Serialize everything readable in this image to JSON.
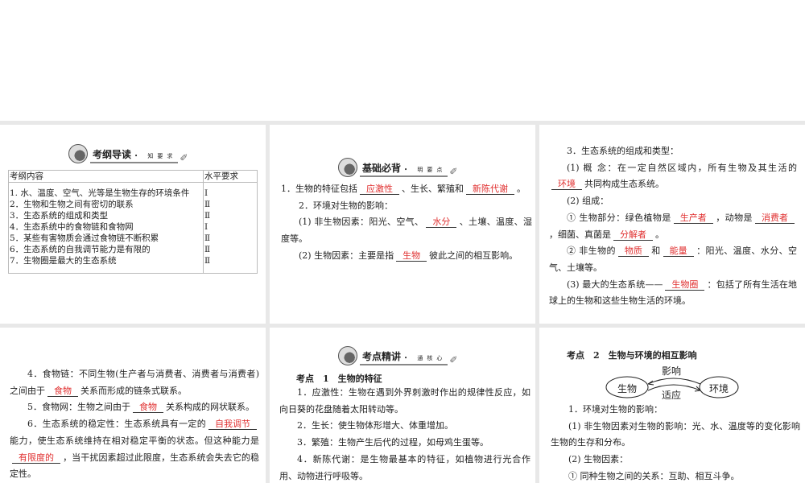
{
  "slides": [
    {
      "badge": {
        "title": "考纲导读",
        "sub": "知要求"
      },
      "table": {
        "headers": [
          "考纲内容",
          "水平要求"
        ],
        "rows": [
          [
            "1. 水、温度、空气、光等是生物生存的环境条件",
            "Ⅰ"
          ],
          [
            "2．生物和生物之间有密切的联系",
            "Ⅱ"
          ],
          [
            "3．生态系统的组成和类型",
            "Ⅱ"
          ],
          [
            "4．生态系统中的食物链和食物网",
            "Ⅰ"
          ],
          [
            "5．某些有害物质会通过食物链不断积累",
            "Ⅱ"
          ],
          [
            "6．生态系统的自我调节能力是有限的",
            "Ⅱ"
          ],
          [
            "7．生物圈是最大的生态系统",
            "Ⅱ"
          ]
        ]
      }
    },
    {
      "badge": {
        "title": "基础必背",
        "sub": "明要点"
      },
      "paras": [
        {
          "ind": false,
          "segs": [
            {
              "t": "1．生物的特征包括"
            },
            {
              "b": "应激性"
            },
            {
              "t": "、生长、繁殖和"
            },
            {
              "b": "新陈代谢"
            },
            {
              "t": "。"
            }
          ]
        },
        {
          "ind": true,
          "segs": [
            {
              "t": "2．环境对生物的影响："
            }
          ]
        },
        {
          "ind": true,
          "segs": [
            {
              "t": "(1) 非生物因素：阳光、空气、"
            },
            {
              "b": "水分"
            },
            {
              "t": "、土壤、温度、湿度等。"
            }
          ]
        },
        {
          "ind": true,
          "segs": [
            {
              "t": "(2) 生物因素：主要是指"
            },
            {
              "b": "生物"
            },
            {
              "t": "彼此之间的相互影响。"
            }
          ]
        }
      ]
    },
    {
      "paras": [
        {
          "ind": true,
          "segs": [
            {
              "t": "3．生态系统的组成和类型："
            }
          ]
        },
        {
          "ind": true,
          "segs": [
            {
              "t": "(1) 概 念：在一定自然区域内，所有生物及其生活的"
            },
            {
              "b": "环境"
            },
            {
              "t": "共同构成生态系统。"
            }
          ]
        },
        {
          "ind": true,
          "segs": [
            {
              "t": "(2) 组成："
            }
          ]
        },
        {
          "ind": true,
          "segs": [
            {
              "t": "① 生物部分：绿色植物是"
            },
            {
              "b": "生产者"
            },
            {
              "t": "，动物是"
            },
            {
              "b": "消费者"
            },
            {
              "t": "，细菌、真菌是"
            },
            {
              "b": "分解者"
            },
            {
              "t": "。"
            }
          ]
        },
        {
          "ind": true,
          "segs": [
            {
              "t": "② 非生物的"
            },
            {
              "b": "物质"
            },
            {
              "t": "和"
            },
            {
              "b": "能量"
            },
            {
              "t": "：阳光、温度、水分、空气、土壤等。"
            }
          ]
        },
        {
          "ind": true,
          "segs": [
            {
              "t": "(3) 最大的生态系统——"
            },
            {
              "b": "生物圈"
            },
            {
              "t": "：包括了所有生活在地球上的生物和这些生物生活的环境。"
            }
          ]
        }
      ]
    },
    {
      "paras": [
        {
          "ind": true,
          "segs": [
            {
              "t": "4．食物链：不同生物(生产者与消费者、消费者与消费者)之间由于"
            },
            {
              "b": "食物"
            },
            {
              "t": "关系而形成的链条式联系。"
            }
          ]
        },
        {
          "ind": true,
          "segs": [
            {
              "t": "5．食物网：生物之间由于"
            },
            {
              "b": "食物"
            },
            {
              "t": "关系构成的网状联系。"
            }
          ]
        },
        {
          "ind": true,
          "segs": [
            {
              "t": "6．生态系统的稳定性：生态系统具有一定的"
            },
            {
              "b": "自我调节"
            },
            {
              "t": "能力，使生态系统维持在相对稳定平衡的状态。但这种能力是"
            },
            {
              "b": "有限度的"
            },
            {
              "t": "，当干扰因素超过此限度，生态系统会失去它的稳定性。"
            }
          ]
        }
      ]
    },
    {
      "badge": {
        "title": "考点精讲",
        "sub": "通核心"
      },
      "heading": "考点　1　生物的特征",
      "paras": [
        {
          "ind": true,
          "segs": [
            {
              "t": "1．应激性：生物在遇到外界刺激时作出的规律性反应，如向日葵的花盘随着太阳转动等。"
            }
          ]
        },
        {
          "ind": true,
          "segs": [
            {
              "t": "2．生长：使生物体形增大、体重增加。"
            }
          ]
        },
        {
          "ind": true,
          "segs": [
            {
              "t": "3．繁殖：生物产生后代的过程，如母鸡生蛋等。"
            }
          ]
        },
        {
          "ind": true,
          "segs": [
            {
              "t": "4．新陈代谢：是生物最基本的特征，如植物进行光合作用、动物进行呼吸等。"
            }
          ]
        }
      ]
    },
    {
      "heading": "考点　2　生物与环境的相互影响",
      "diagram": {
        "left": "生物",
        "right": "环境",
        "top": "影响",
        "bottom": "适应"
      },
      "paras": [
        {
          "ind": true,
          "segs": [
            {
              "t": "1．环境对生物的影响："
            }
          ]
        },
        {
          "ind": true,
          "segs": [
            {
              "t": "(1) 非生物因素对生物的影响：光、水、温度等的变化影响生物的生存和分布。"
            }
          ]
        },
        {
          "ind": true,
          "segs": [
            {
              "t": "(2) 生物因素："
            }
          ]
        },
        {
          "ind": true,
          "segs": [
            {
              "t": "① 同种生物之间的关系：互助、相互斗争。"
            }
          ]
        }
      ]
    }
  ]
}
